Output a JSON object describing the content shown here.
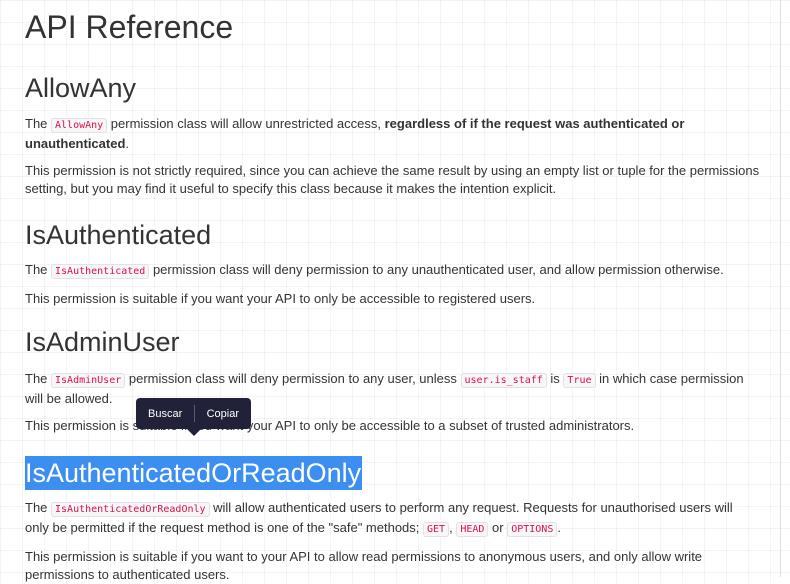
{
  "page": {
    "title": "API Reference"
  },
  "sections": [
    {
      "heading": "AllowAny",
      "p1": {
        "pre": "The ",
        "code": "AllowAny",
        "mid": " permission class will allow unrestricted access, ",
        "bold": "regardless of if the request was authenticated or unauthenticated",
        "post": "."
      },
      "p2": "This permission is not strictly required, since you can achieve the same result by using an empty list or tuple for the permissions setting, but you may find it useful to specify this class because it makes the intention explicit."
    },
    {
      "heading": "IsAuthenticated",
      "p1": {
        "pre": "The ",
        "code": "IsAuthenticated",
        "post": " permission class will deny permission to any unauthenticated user, and allow permission otherwise."
      },
      "p2": "This permission is suitable if you want your API to only be accessible to registered users."
    },
    {
      "heading": "IsAdminUser",
      "p1": {
        "pre": "The ",
        "code": "IsAdminUser",
        "mid1": " permission class will deny permission to any user, unless ",
        "code2": "user.is_staff",
        "mid2": " is ",
        "code3": "True",
        "post": " in which case permission will be allowed."
      },
      "p2": "This permission is suitable if you want your API to only be accessible to a subset of trusted administrators."
    },
    {
      "heading": "IsAuthenticatedOrReadOnly",
      "p1": {
        "pre": "The ",
        "code": "IsAuthenticatedOrReadOnly",
        "mid1": " will allow authenticated users to perform any request. Requests for unauthorised users will only be permitted if the request method is one of the \"safe\" methods; ",
        "code2": "GET",
        "mid2": ", ",
        "code3": "HEAD",
        "mid3": " or ",
        "code4": "OPTIONS",
        "post": "."
      },
      "p2": "This permission is suitable if you want to your API to allow read permissions to anonymous users, and only allow write permissions to authenticated users."
    }
  ],
  "selection_popup": {
    "search_label": "Buscar",
    "copy_label": "Copiar",
    "background": "#21213a"
  },
  "colors": {
    "code_text": "#dd1144",
    "selection": "#3c8ef1",
    "body_text": "#333333"
  }
}
